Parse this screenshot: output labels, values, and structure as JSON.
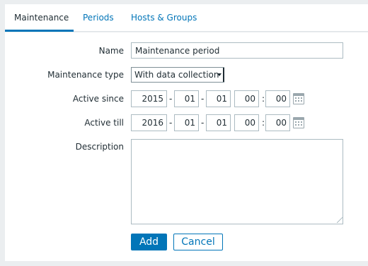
{
  "tabs": [
    {
      "label": "Maintenance",
      "active": true
    },
    {
      "label": "Periods",
      "active": false
    },
    {
      "label": "Hosts & Groups",
      "active": false
    }
  ],
  "form": {
    "name_label": "Name",
    "name_value": "Maintenance period",
    "type_label": "Maintenance type",
    "type_value": "With data collection",
    "since_label": "Active since",
    "since": {
      "year": "2015",
      "month": "01",
      "day": "01",
      "hour": "00",
      "minute": "00"
    },
    "till_label": "Active till",
    "till": {
      "year": "2016",
      "month": "01",
      "day": "01",
      "hour": "00",
      "minute": "00"
    },
    "description_label": "Description",
    "description_value": "",
    "date_sep": "-",
    "time_sep": ":"
  },
  "buttons": {
    "add": "Add",
    "cancel": "Cancel"
  },
  "icons": {
    "calendar": "calendar-icon"
  },
  "colors": {
    "accent": "#0275b8",
    "background": "#ebeef0",
    "text": "#1f2c33"
  }
}
